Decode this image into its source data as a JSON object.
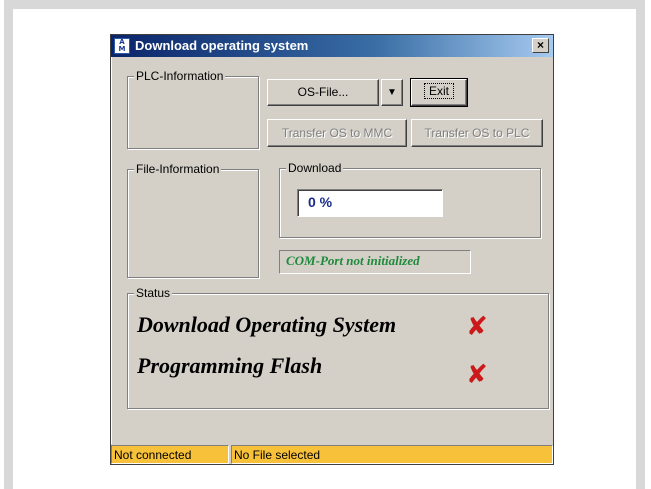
{
  "window": {
    "title": "Download operating system",
    "close_glyph": "×",
    "icon_name": "app-icon"
  },
  "plc_group": {
    "title": "PLC-Information"
  },
  "file_group": {
    "title": "File-Information"
  },
  "buttons": {
    "os_file": "OS-File...",
    "dropdown_glyph": "▼",
    "exit": "Exit",
    "transfer_mmc": "Transfer OS to MMC",
    "transfer_plc": "Transfer OS to PLC"
  },
  "download": {
    "title": "Download",
    "progress_text": "0 %",
    "progress_percent": 0
  },
  "com_port_status": "COM-Port not initialized",
  "status": {
    "title": "Status",
    "lines": [
      {
        "text": "Download Operating System",
        "state": "failed",
        "mark": "✘"
      },
      {
        "text": "Programming Flash",
        "state": "failed",
        "mark": "✘"
      }
    ]
  },
  "statusbar": {
    "connection": "Not connected",
    "file": "No File selected"
  },
  "colors": {
    "title_gradient_start": "#0a246a",
    "status_bar_fill": "#f8c13a",
    "error_mark": "#cc1a1a",
    "com_status_text": "#1f8a3c",
    "progress_text": "#1a2b8c"
  }
}
